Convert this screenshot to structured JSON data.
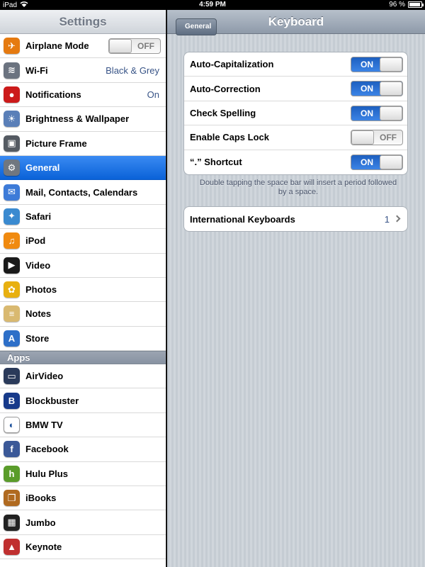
{
  "status_bar": {
    "device": "iPad",
    "time": "4:59 PM",
    "battery": "96 %",
    "battery_level": 0.96
  },
  "left_pane": {
    "title": "Settings",
    "items": [
      {
        "label": "Airplane Mode",
        "icon": "airplane-icon",
        "switch": "OFF"
      },
      {
        "label": "Wi-Fi",
        "icon": "wifi-icon",
        "value": "Black & Grey"
      },
      {
        "label": "Notifications",
        "icon": "notifications-icon",
        "value": "On"
      },
      {
        "label": "Brightness & Wallpaper",
        "icon": "brightness-icon"
      },
      {
        "label": "Picture Frame",
        "icon": "picture-frame-icon"
      },
      {
        "label": "General",
        "icon": "gear-icon",
        "selected": true
      },
      {
        "label": "Mail, Contacts, Calendars",
        "icon": "mail-icon"
      },
      {
        "label": "Safari",
        "icon": "compass-icon"
      },
      {
        "label": "iPod",
        "icon": "ipod-icon"
      },
      {
        "label": "Video",
        "icon": "video-icon"
      },
      {
        "label": "Photos",
        "icon": "photos-icon"
      },
      {
        "label": "Notes",
        "icon": "notes-icon"
      },
      {
        "label": "Store",
        "icon": "store-icon"
      }
    ],
    "apps_header": "Apps",
    "apps": [
      {
        "label": "AirVideo",
        "icon": "airvideo-icon"
      },
      {
        "label": "Blockbuster",
        "icon": "blockbuster-icon"
      },
      {
        "label": "BMW TV",
        "icon": "bmw-icon"
      },
      {
        "label": "Facebook",
        "icon": "facebook-icon"
      },
      {
        "label": "Hulu Plus",
        "icon": "hulu-icon"
      },
      {
        "label": "iBooks",
        "icon": "ibooks-icon"
      },
      {
        "label": "Jumbo",
        "icon": "jumbo-icon"
      },
      {
        "label": "Keynote",
        "icon": "keynote-icon"
      }
    ]
  },
  "right_pane": {
    "title": "Keyboard",
    "back_label": "General",
    "toggles": [
      {
        "label": "Auto-Capitalization",
        "state": "ON"
      },
      {
        "label": "Auto-Correction",
        "state": "ON"
      },
      {
        "label": "Check Spelling",
        "state": "ON"
      },
      {
        "label": "Enable Caps Lock",
        "state": "OFF"
      },
      {
        "label": "“.” Shortcut",
        "state": "ON"
      }
    ],
    "footnote": "Double tapping the space bar will insert a period followed by a space.",
    "international": {
      "label": "International Keyboards",
      "count": "1"
    }
  },
  "colors": {
    "selected": "#0a62d8",
    "value_text": "#385487",
    "switch_on": "#2f74d8"
  }
}
